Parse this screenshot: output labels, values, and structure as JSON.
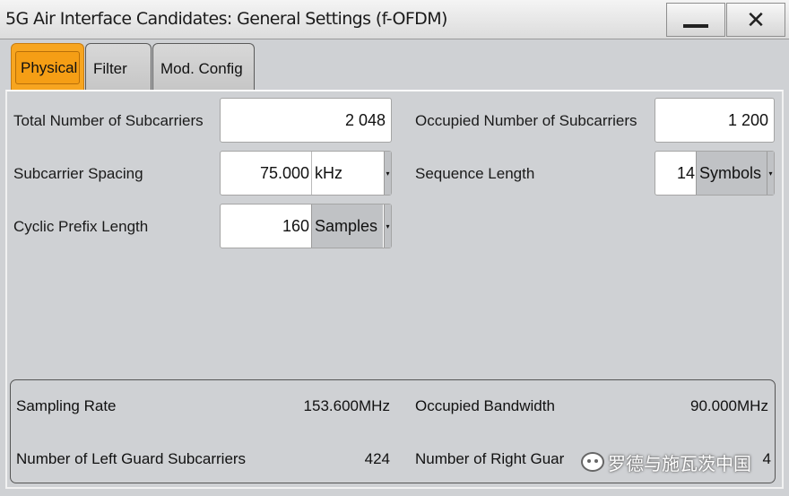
{
  "window": {
    "title": "5G Air Interface Candidates: General Settings (f-OFDM)",
    "minimize_symbol": "—",
    "close_symbol": "✕"
  },
  "tabs": [
    {
      "label": "Physical",
      "active": true
    },
    {
      "label": "Filter",
      "active": false
    },
    {
      "label": "Mod. Config",
      "active": false
    }
  ],
  "fields": {
    "total_subcarriers": {
      "label": "Total Number of Subcarriers",
      "value": "2 048"
    },
    "occupied_subcarriers": {
      "label": "Occupied Number of Subcarriers",
      "value": "1 200"
    },
    "subcarrier_spacing": {
      "label": "Subcarrier Spacing",
      "value": "75.000",
      "unit": "kHz"
    },
    "sequence_length": {
      "label": "Sequence Length",
      "value": "14",
      "unit": "Symbols"
    },
    "cyclic_prefix": {
      "label": "Cyclic Prefix Length",
      "value": "160",
      "unit": "Samples"
    }
  },
  "info": {
    "sampling_rate": {
      "label": "Sampling Rate",
      "value": "153.600",
      "unit": "MHz"
    },
    "occupied_bandwidth": {
      "label": "Occupied Bandwidth",
      "value": "90.000",
      "unit": "MHz"
    },
    "left_guard": {
      "label": "Number of Left Guard Subcarriers",
      "value": "424"
    },
    "right_guard": {
      "label": "Number of Right Guar",
      "value": "4"
    }
  },
  "watermark": {
    "text": "罗德与施瓦茨中国"
  },
  "colors": {
    "active_tab": "#f7a520",
    "panel": "#cfd1d4"
  }
}
